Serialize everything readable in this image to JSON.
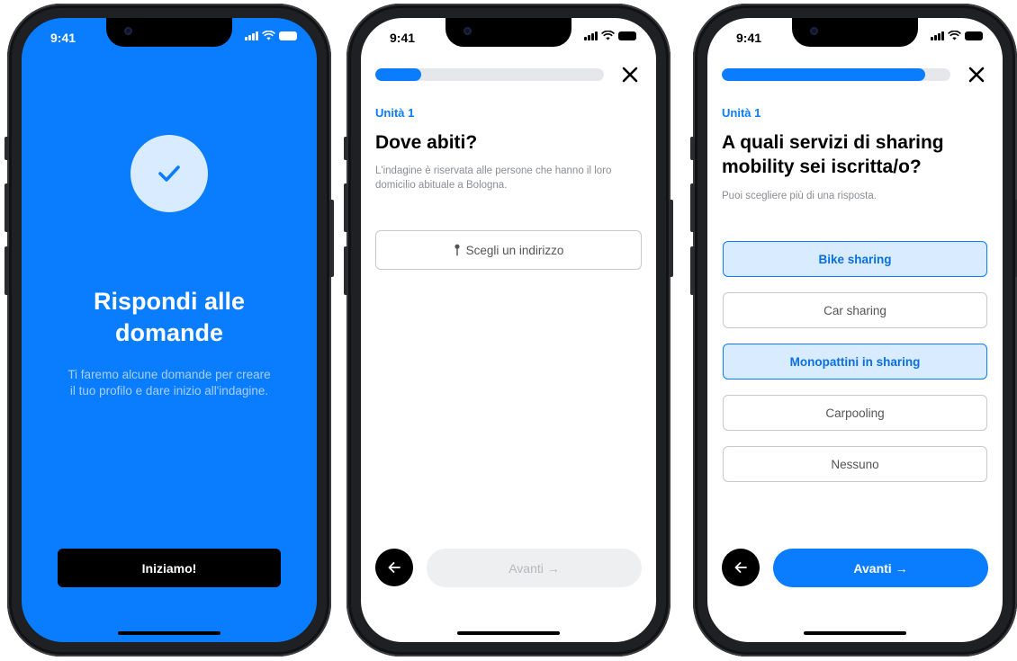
{
  "status_bar": {
    "time": "9:41"
  },
  "screen1": {
    "title": "Rispondi alle domande",
    "description": "Ti faremo alcune domande per creare il tuo profilo e dare inizio all'indagine.",
    "cta_label": "Iniziamo!"
  },
  "screen2": {
    "progress": 0.2,
    "unit": "Unità 1",
    "title": "Dove abiti?",
    "description": "L'indagine è riservata alle persone che hanno il loro domicilio abituale a Bologna.",
    "address_label": "Scegli un indirizzo",
    "next_label": "Avanti →"
  },
  "screen3": {
    "progress": 0.89,
    "unit": "Unità 1",
    "title": "A quali servizi di sharing mobility sei iscritta/o?",
    "description": "Puoi scegliere più di una risposta.",
    "options": [
      {
        "label": "Bike sharing",
        "selected": true
      },
      {
        "label": "Car sharing",
        "selected": false
      },
      {
        "label": "Monopattini in sharing",
        "selected": true
      },
      {
        "label": "Carpooling",
        "selected": false
      },
      {
        "label": "Nessuno",
        "selected": false
      }
    ],
    "next_label": "Avanti →"
  },
  "colors": {
    "brand_blue": "#0a7dff",
    "selected_bg": "#d8ebff"
  },
  "icons": {
    "check": "check-icon",
    "close": "close-icon",
    "back": "arrow-left-icon",
    "pin": "pin-icon"
  }
}
